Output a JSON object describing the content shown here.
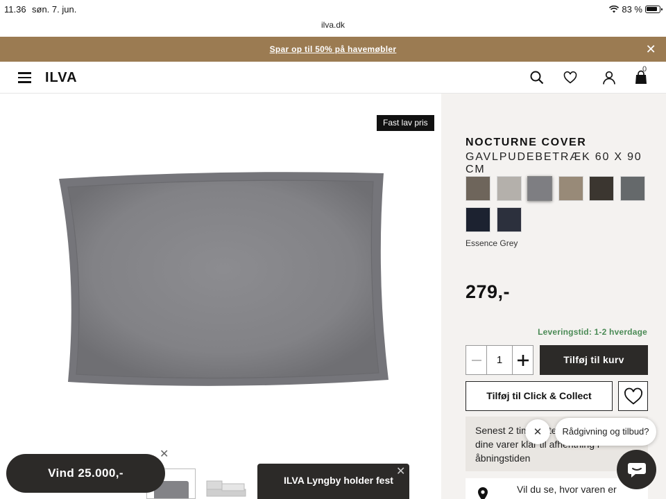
{
  "status_bar": {
    "time": "11.36",
    "date": "søn. 7. jun.",
    "battery": "83 %"
  },
  "browser": {
    "url": "ilva.dk"
  },
  "promo": {
    "text": "Spar op til 50% på havemøbler",
    "close": "✕"
  },
  "header": {
    "logo": "ILVA",
    "cart_count": "0",
    "icons": [
      "menu-icon",
      "search-icon",
      "heart-icon",
      "user-icon",
      "bag-icon"
    ]
  },
  "product": {
    "badge": "Fast lav pris",
    "name": "NOCTURNE COVER",
    "description": "GAVLPUDEBETRÆK 60 X 90 CM",
    "selected_color": "Essence Grey",
    "swatches": [
      "#6e655b",
      "#b4b0ab",
      "#7e7e82",
      "#988a78",
      "#3b3630",
      "#65696b",
      "#1c2230",
      "#2c303d"
    ],
    "selected_index": 2,
    "price": "279,-",
    "delivery": "Leveringstid: 1-2 hverdage",
    "quantity": "1",
    "add_to_cart": "Tilføj til kurv",
    "click_collect": "Tilføj til Click & Collect",
    "info_text": "Senest 2 timer efter ordren er du vare dine varer klar til afhentning i åbningstiden",
    "location_text": "Vil du se, hvor varen er udstillet?"
  },
  "overlays": {
    "vind": "Vind 25.000,-",
    "lyngby": "ILVA Lyngby holder fest",
    "chat_prompt": "Rådgivning og tilbud?"
  },
  "colors": {
    "promo": "#9b7b52",
    "dark": "#2c2a28",
    "panel": "#f4f2f0",
    "delivery": "#4a8a55"
  }
}
